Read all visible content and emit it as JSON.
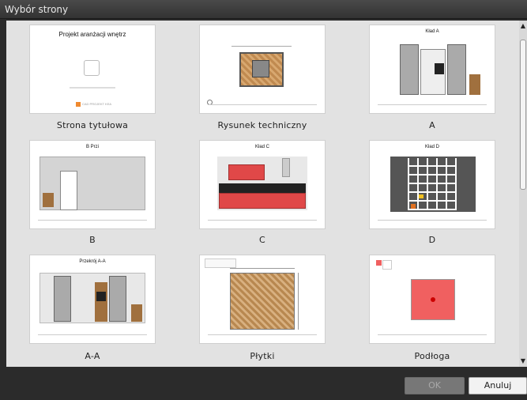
{
  "dialog": {
    "title": "Wybór strony"
  },
  "pages": [
    {
      "label": "Strona tytułowa",
      "thumb_title": "Projekt aranżacji wnętrz",
      "footer_text": "CAD PROJEKT KEA"
    },
    {
      "label": "Rysunek techniczny",
      "thumb_title": ""
    },
    {
      "label": "A",
      "thumb_title": "Kład A"
    },
    {
      "label": "B",
      "thumb_title": "B Przi"
    },
    {
      "label": "C",
      "thumb_title": "Kład C"
    },
    {
      "label": "D",
      "thumb_title": "Kład D"
    },
    {
      "label": "A-A",
      "thumb_title": "Przekrój A-A"
    },
    {
      "label": "Płytki",
      "thumb_title": ""
    },
    {
      "label": "Podłoga",
      "thumb_title": ""
    }
  ],
  "buttons": {
    "ok": "OK",
    "cancel": "Anuluj"
  },
  "icons": {
    "scroll_up": "scroll-up-arrow-icon",
    "scroll_down": "scroll-down-arrow-icon"
  },
  "colors": {
    "kitchen_red": "#e04848",
    "floor_red": "#f06060",
    "wood": "#a0703e"
  }
}
